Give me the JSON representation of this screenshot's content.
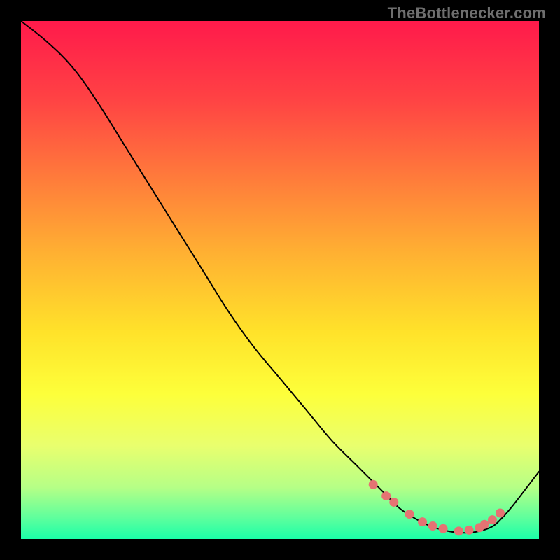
{
  "watermark": "TheBottlenecker.com",
  "chart_data": {
    "type": "line",
    "title": "",
    "xlabel": "",
    "ylabel": "",
    "xlim": [
      0,
      100
    ],
    "ylim": [
      0,
      100
    ],
    "background_gradient_stops": [
      {
        "offset": 0.0,
        "color": "#ff1a4b"
      },
      {
        "offset": 0.15,
        "color": "#ff4244"
      },
      {
        "offset": 0.3,
        "color": "#ff7a3b"
      },
      {
        "offset": 0.45,
        "color": "#ffb132"
      },
      {
        "offset": 0.6,
        "color": "#ffe22a"
      },
      {
        "offset": 0.72,
        "color": "#fdff3a"
      },
      {
        "offset": 0.82,
        "color": "#e9ff6e"
      },
      {
        "offset": 0.9,
        "color": "#b6ff86"
      },
      {
        "offset": 0.96,
        "color": "#5dff9d"
      },
      {
        "offset": 1.0,
        "color": "#1bffa8"
      }
    ],
    "series": [
      {
        "name": "curve",
        "type": "line",
        "x": [
          0,
          5,
          10,
          15,
          20,
          25,
          30,
          35,
          40,
          45,
          50,
          55,
          60,
          65,
          70,
          73,
          76,
          79,
          82,
          85,
          88,
          91,
          93,
          95,
          100
        ],
        "y": [
          100,
          96,
          91,
          84,
          76,
          68,
          60,
          52,
          44,
          37,
          31,
          25,
          19,
          14,
          9,
          6,
          4,
          2.5,
          1.6,
          1.2,
          1.4,
          2.4,
          4.2,
          6.5,
          13
        ]
      },
      {
        "name": "markers",
        "type": "scatter",
        "x": [
          68,
          70.5,
          72,
          75,
          77.5,
          79.5,
          81.5,
          84.5,
          86.5,
          88.5,
          89.5,
          91,
          92.5
        ],
        "y": [
          10.5,
          8.3,
          7.1,
          4.8,
          3.3,
          2.5,
          2.0,
          1.5,
          1.7,
          2.2,
          2.8,
          3.7,
          5.0
        ]
      }
    ],
    "curve_color": "#000000",
    "marker_color": "#e57373",
    "marker_radius": 6.5
  }
}
